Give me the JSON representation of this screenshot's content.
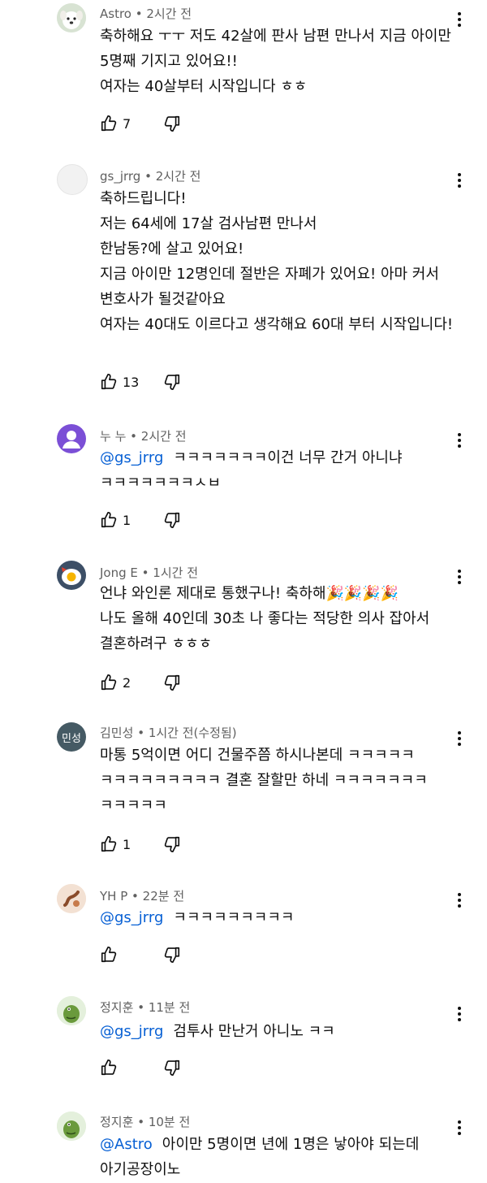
{
  "comments": [
    {
      "avatar": "dog-avatar",
      "username": "Astro",
      "time": "2시간 전",
      "text": "축하해요 ㅜㅜ 저도  42살에 판사 남편 만나서 지금 아이만 5명째 기지고 있어요!!\n여자는 40살부터 시작입니다 ㅎㅎ",
      "likes": "7"
    },
    {
      "avatar": "blank-avatar",
      "username": "gs_jrrg",
      "time": "2시간 전",
      "text": "축하드립니다!\n저는 64세에 17살 검사남편 만나서\n한남동?에 살고 있어요!\n지금 아이만 12명인데 절반은 자폐가 있어요! 아마 커서 변호사가 될것같아요\n여자는 40대도 이르다고 생각해요 60대 부터 시작입니다!",
      "likes": "13"
    },
    {
      "avatar": "default-person-avatar",
      "username": "누 누",
      "time": "2시간 전",
      "mention": "@gs_jrrg",
      "text": "ㅋㅋㅋㅋㅋㅋㅋ이건 너무 간거 아니냐 ㅋㅋㅋㅋㅋㅋㅋㅅㅂ",
      "likes": "1"
    },
    {
      "avatar": "egg-avatar",
      "username": "Jong E",
      "time": "1시간 전",
      "text": "언냐 와인론 제대로 통했구나! 축하해🎉🎉🎉🎉\n나도 올해 40인데 30초 나 좋다는 적당한 의사 잡아서 결혼하려구 ㅎㅎㅎ",
      "likes": "2"
    },
    {
      "avatar": "initials-avatar",
      "avatar_text": "민성",
      "username": "김민성",
      "time": "1시간 전(수정됨)",
      "text": "마통 5억이면 어디 건물주쯤 하시나본데 ㅋㅋㅋㅋㅋ ㅋㅋㅋㅋㅋㅋㅋㅋㅋ 결혼 잘할만 하네 ㅋㅋㅋㅋㅋㅋㅋ ㅋㅋㅋㅋㅋ",
      "likes": "1"
    },
    {
      "avatar": "cartoon-avatar",
      "username": "YH P",
      "time": "22분 전",
      "mention": "@gs_jrrg",
      "text": "ㅋㅋㅋㅋㅋㅋㅋㅋㅋ",
      "likes": ""
    },
    {
      "avatar": "dino-avatar",
      "username": "정지훈",
      "time": "11분 전",
      "mention": "@gs_jrrg",
      "text": "검투사 만난거 아니노 ㅋㅋ",
      "likes": ""
    },
    {
      "avatar": "dino-avatar",
      "username": "정지훈",
      "time": "10분 전",
      "mention": "@Astro",
      "text": "아이만 5명이면 년에 1명은 낳아야 되는데 아기공장이노",
      "likes": ""
    }
  ],
  "colors": {
    "mention": "#065fd4",
    "meta": "#606060",
    "initials_bg": "#455a64",
    "person_bg": "#7b4fd6"
  },
  "icons": [
    "thumbs-up-icon",
    "thumbs-down-icon",
    "more-vert-icon"
  ]
}
